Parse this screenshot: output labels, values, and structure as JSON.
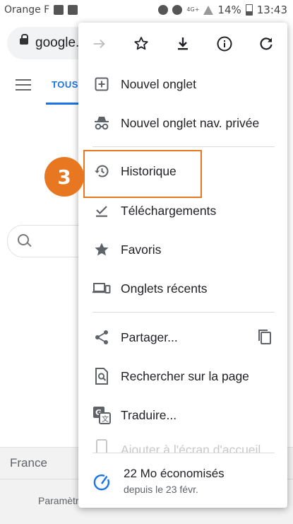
{
  "status_bar": {
    "carrier": "Orange F",
    "network": "4G+",
    "battery": "14%",
    "time": "13:43"
  },
  "background_page": {
    "url": "google.",
    "tab_all": "TOUS",
    "country": "France",
    "footer_link": "Paramètres"
  },
  "menu": {
    "toolbar": {
      "forward_icon": "arrow-forward-icon",
      "bookmark_icon": "star-outline-icon",
      "download_icon": "download-icon",
      "info_icon": "info-icon",
      "reload_icon": "reload-icon"
    },
    "items": [
      {
        "label": "Nouvel onglet",
        "icon": "new-tab-icon"
      },
      {
        "label": "Nouvel onglet nav. privée",
        "icon": "incognito-icon"
      },
      {
        "label": "Historique",
        "icon": "history-icon"
      },
      {
        "label": "Téléchargements",
        "icon": "downloads-icon"
      },
      {
        "label": "Favoris",
        "icon": "bookmarks-star-icon"
      },
      {
        "label": "Onglets récents",
        "icon": "devices-icon"
      },
      {
        "label": "Partager...",
        "icon": "share-icon"
      },
      {
        "label": "Rechercher sur la page",
        "icon": "find-in-page-icon"
      },
      {
        "label": "Traduire...",
        "icon": "translate-icon"
      },
      {
        "label": "Ajouter à l'écran d'accueil",
        "icon": "add-to-home-icon"
      }
    ],
    "share_copy_icon": "copy-icon",
    "savings": {
      "title": "22 Mo économisés",
      "subtitle": "depuis le 23 févr."
    }
  },
  "step_badge": "3",
  "colors": {
    "accent_orange": "#e87722",
    "google_blue": "#1a73e8",
    "icon_gray": "#5f6368"
  }
}
